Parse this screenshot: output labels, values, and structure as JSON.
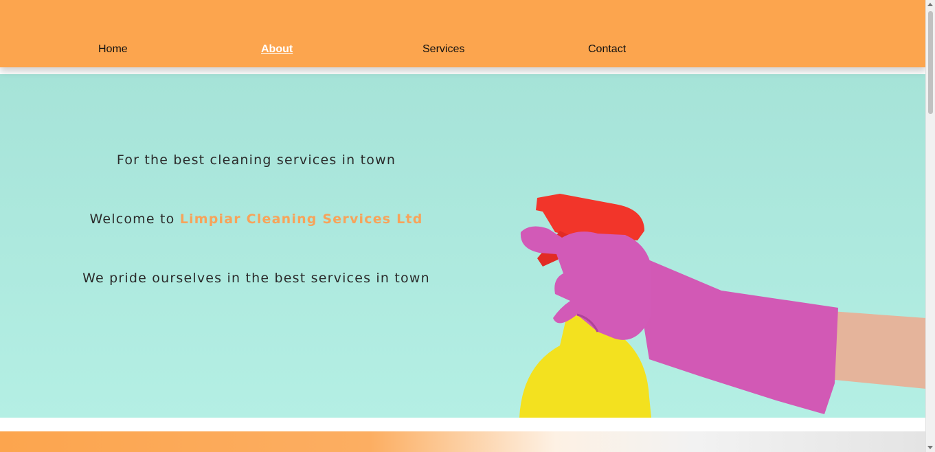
{
  "nav": {
    "items": [
      {
        "label": "Home",
        "active": false
      },
      {
        "label": "About",
        "active": true
      },
      {
        "label": "Services",
        "active": false
      },
      {
        "label": "Contact",
        "active": false
      }
    ]
  },
  "hero": {
    "tagline": "For the best cleaning services in town",
    "welcome_prefix": "Welcome to",
    "brand_name": "Limpiar Cleaning Services Ltd",
    "subtitle": "We pride ourselves in the best services in town",
    "image_icon": "spray-bottle-glove-icon"
  },
  "colors": {
    "navbar": "#fca54e",
    "hero_bg": "#a6e3d8",
    "brand": "#f7a35a",
    "active_nav": "#ffffff"
  }
}
